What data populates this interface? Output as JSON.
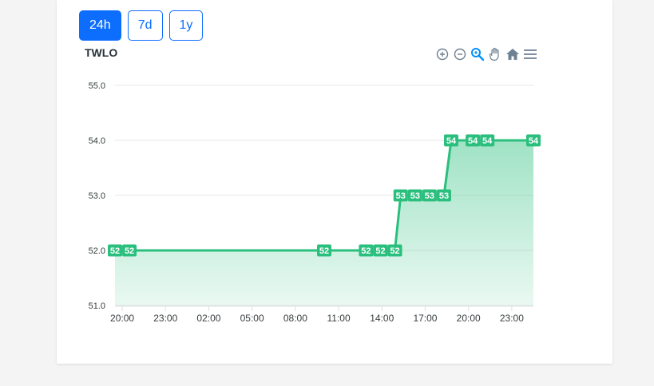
{
  "range_buttons": [
    {
      "label": "24h",
      "active": true
    },
    {
      "label": "7d",
      "active": false
    },
    {
      "label": "1y",
      "active": false
    }
  ],
  "toolbar_icons": [
    "zoom-in-icon",
    "zoom-out-icon",
    "zoom-select-icon",
    "pan-hand-icon",
    "home-reset-icon",
    "menu-icon"
  ],
  "colors": {
    "accent": "#0d6efd",
    "series": "#2bbf7e",
    "toolbar_icon": "#6e8192",
    "toolbar_active": "#008ffb"
  },
  "chart_data": {
    "type": "area",
    "title": "TWLO",
    "xlabel": "",
    "ylabel": "",
    "ylim": [
      51,
      55
    ],
    "y_ticks": [
      "55.0",
      "54.0",
      "53.0",
      "52.0",
      "51.0"
    ],
    "x_ticks": [
      "20:00",
      "23:00",
      "02:00",
      "05:00",
      "08:00",
      "11:00",
      "14:00",
      "17:00",
      "20:00",
      "23:00"
    ],
    "x_range_hours": [
      19.5,
      48.5
    ],
    "grid": true,
    "legend": "none",
    "series": [
      {
        "points": [
          {
            "x": 19.5,
            "y": 52.0,
            "label": "52"
          },
          {
            "x": 20.5,
            "y": 52.0,
            "label": "52"
          },
          {
            "x": 34.0,
            "y": 52.0,
            "label": "52"
          },
          {
            "x": 36.9,
            "y": 52.0,
            "label": "52"
          },
          {
            "x": 37.9,
            "y": 52.0,
            "label": "52"
          },
          {
            "x": 38.9,
            "y": 52.0,
            "label": "52"
          },
          {
            "x": 39.3,
            "y": 53.0,
            "label": "53"
          },
          {
            "x": 40.3,
            "y": 53.0,
            "label": "53"
          },
          {
            "x": 41.3,
            "y": 53.0,
            "label": "53"
          },
          {
            "x": 42.3,
            "y": 53.0,
            "label": "53"
          },
          {
            "x": 42.8,
            "y": 54.0,
            "label": "54"
          },
          {
            "x": 44.3,
            "y": 54.0,
            "label": "54"
          },
          {
            "x": 45.3,
            "y": 54.0,
            "label": "54"
          },
          {
            "x": 46.3,
            "y": 54.0,
            "label": ""
          },
          {
            "x": 48.5,
            "y": 54.0,
            "label": "54"
          }
        ]
      }
    ]
  }
}
